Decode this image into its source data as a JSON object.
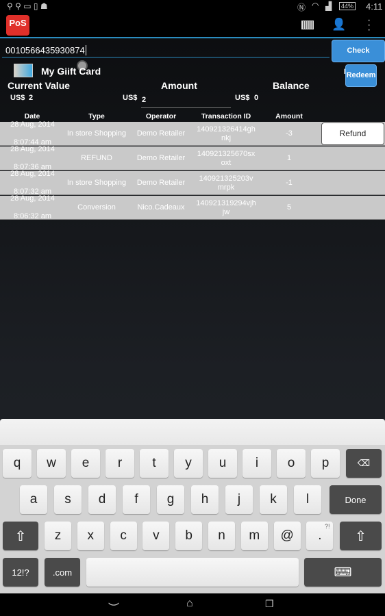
{
  "status": {
    "time": "4:11",
    "battery": "44%"
  },
  "app": {
    "logo": "PoS",
    "icons": [
      "barcode-icon",
      "add-user-icon",
      "overflow-menu-icon"
    ]
  },
  "card": {
    "number": "0010566435930874",
    "name": "My Giift Card",
    "check_balance": "Check Balance",
    "redeem": "Redeem"
  },
  "summary": {
    "current_label": "Current Value",
    "amount_label": "Amount",
    "balance_label": "Balance",
    "currency": "US$",
    "current_value": "2",
    "amount_value": "2",
    "balance_value": "0"
  },
  "table": {
    "headers": [
      "Date",
      "Type",
      "Operator",
      "Transaction ID",
      "Amount"
    ],
    "rows": [
      {
        "date": "28 Aug, 2014",
        "time": "8:07:44 am",
        "type": "In store Shopping",
        "operator": "Demo Retailer",
        "id": "140921326414ghnkj",
        "amount": "-3"
      },
      {
        "date": "28 Aug, 2014",
        "time": "8:07:36 am",
        "type": "REFUND",
        "operator": "Demo Retailer",
        "id": "140921325670sxoxt",
        "amount": "1"
      },
      {
        "date": "28 Aug, 2014",
        "time": "8:07:32 am",
        "type": "In store Shopping",
        "operator": "Demo Retailer",
        "id": "140921325203vmrpk",
        "amount": "-1"
      },
      {
        "date": "28 Aug, 2014",
        "time": "8:06:32 am",
        "type": "Conversion",
        "operator": "Nico.Cadeaux",
        "id": "140921319294vjhjw",
        "amount": "5"
      }
    ],
    "refund": "Refund"
  },
  "keyboard": {
    "row1": [
      "q",
      "w",
      "e",
      "r",
      "t",
      "y",
      "u",
      "i",
      "o",
      "p"
    ],
    "row2": [
      "a",
      "s",
      "d",
      "f",
      "g",
      "h",
      "j",
      "k",
      "l"
    ],
    "row3": [
      "z",
      "x",
      "c",
      "v",
      "b",
      "n",
      "m",
      "@",
      "."
    ],
    "done": "Done",
    "symbols": "12!?",
    "dotcom": ".com",
    "period_hint": "?!"
  }
}
